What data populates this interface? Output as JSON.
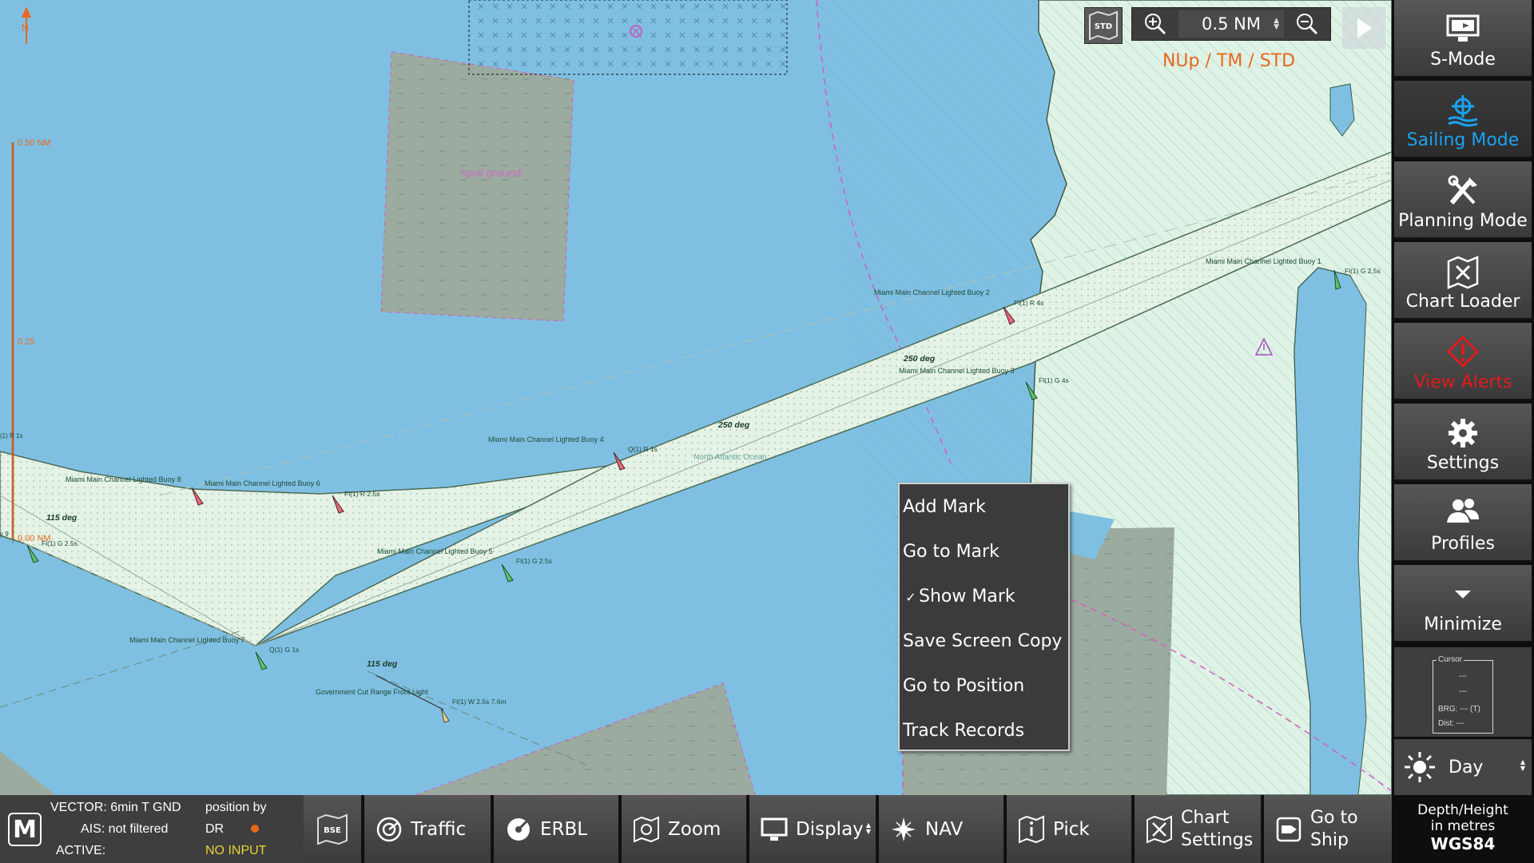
{
  "map": {
    "north_label": "N",
    "scale_labels": [
      "0.50 NM",
      "0.25",
      "0.00 NM"
    ],
    "spoil_ground": "spoil ground",
    "ocean_label": "North Atlantic Ocean",
    "degree_labels": [
      "250 deg",
      "250 deg",
      "115 deg",
      "115 deg"
    ],
    "buoys": [
      {
        "name": "Miami Main Channel Lighted Buoy 1",
        "light": "Fl(1) G 2.5s"
      },
      {
        "name": "Miami Main Channel Lighted Buoy 2",
        "light": "Fl(1) R 4s"
      },
      {
        "name": "Miami Main Channel Lighted Buoy 3",
        "light": "Fl(1) G 4s"
      },
      {
        "name": "Miami Main Channel Lighted Buoy 4",
        "light": "Q(1) R 1s"
      },
      {
        "name": "Miami Main Channel Lighted Buoy 5",
        "light": "Fl(1) G 2.5s"
      },
      {
        "name": "Miami Main Channel Lighted Buoy 6",
        "light": "Fl(1) R 2.5s"
      },
      {
        "name": "Miami Main Channel Lighted Buoy 7",
        "light": "Q(1) G 1s"
      },
      {
        "name": "Miami Main Channel Lighted Buoy 8",
        "light": "Fl(1) G 2.5s"
      }
    ],
    "range_light": {
      "name": "Government Cut Range Front Light",
      "light": "Fl(1) W 2.5s 7.6m"
    },
    "edge_label": "(1) R 1s",
    "edge_label_2": "y 9"
  },
  "top_controls": {
    "std_label": "STD",
    "zoom_value": "0.5 NM",
    "orientation": "NUp / TM / STD"
  },
  "context_menu": {
    "items": [
      {
        "label": "Add Mark",
        "checked": false
      },
      {
        "label": "Go to Mark",
        "checked": false
      },
      {
        "label": "Show Mark",
        "checked": true,
        "check": "✓"
      },
      {
        "label": "Save Screen Copy",
        "checked": false
      },
      {
        "label": "Go to Position",
        "checked": false
      },
      {
        "label": "Track Records",
        "checked": false
      }
    ]
  },
  "sidebar": {
    "items": [
      {
        "label": "S-Mode",
        "icon": "monitor-icon"
      },
      {
        "label": "Sailing Mode",
        "icon": "ship-wheel-icon",
        "active": true
      },
      {
        "label": "Planning Mode",
        "icon": "tools-icon"
      },
      {
        "label": "Chart Loader",
        "icon": "chart-map-icon"
      },
      {
        "label": "View Alerts",
        "icon": "alert-icon"
      },
      {
        "label": "Settings",
        "icon": "gear-icon"
      },
      {
        "label": "Profiles",
        "icon": "users-icon"
      },
      {
        "label": "Minimize",
        "icon": "chevron-down-icon"
      }
    ],
    "cursor": {
      "title": "Cursor",
      "line1": "---",
      "line2": "---",
      "brg_label": "BRG:",
      "brg_value": "---",
      "brg_unit": "(T)",
      "dist_label": "Dist:",
      "dist_value": "---"
    },
    "day_mode": "Day",
    "depth_label": "Depth/Height",
    "depth_unit": "in metres",
    "datum": "WGS84"
  },
  "status": {
    "logo": "M",
    "vector": "VECTOR: 6min T GND",
    "ais": "AIS: not filtered",
    "active": "ACTIVE:",
    "position_by": "position by",
    "position_source": "DR",
    "no_input": "NO INPUT"
  },
  "bottom_bar": {
    "bse": "BSE",
    "traffic": "Traffic",
    "erbl": "ERBL",
    "zoom": "Zoom",
    "display": "Display",
    "nav": "NAV",
    "pick": "Pick",
    "chart_settings_1": "Chart",
    "chart_settings_2": "Settings",
    "goto_ship_1": "Go to",
    "goto_ship_2": "Ship"
  },
  "colors": {
    "sea": "#7fc0e2",
    "land": "#dff2e6",
    "channel": "#e4f3e6",
    "shoal": "#9bab9f",
    "accent_orange": "#e8671d",
    "active_blue": "#1aa3f2",
    "alert_red": "#e01b1b"
  }
}
